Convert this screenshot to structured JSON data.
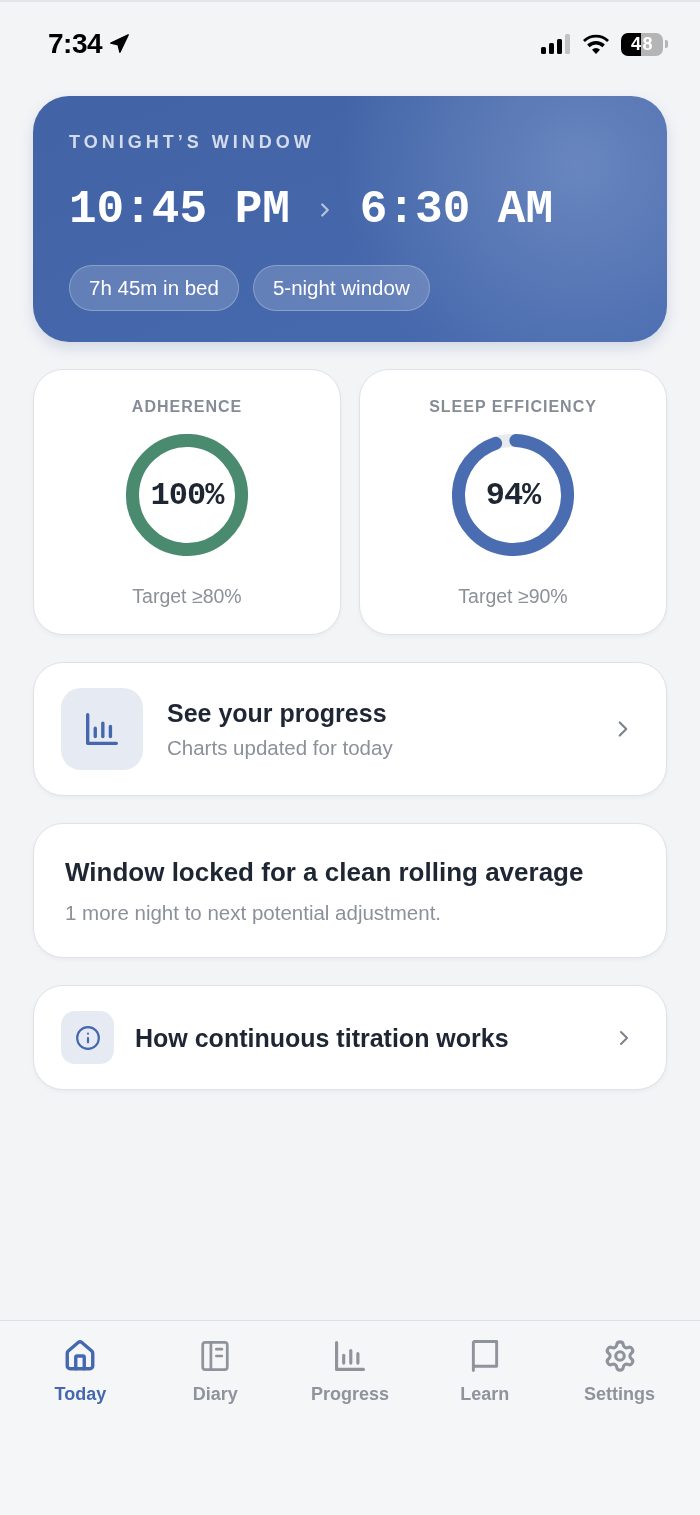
{
  "status_bar": {
    "time": "7:34",
    "battery": "48"
  },
  "window_card": {
    "title": "TONIGHT’S WINDOW",
    "start": "10:45 PM",
    "end": "6:30 AM",
    "chips": [
      "7h 45m in bed",
      "5-night window"
    ]
  },
  "metrics": [
    {
      "label": "ADHERENCE",
      "value": "100%",
      "level": 1,
      "color": "#4a8a6e",
      "target": "Target ≥80%"
    },
    {
      "label": "SLEEP EFFICIENCY",
      "value": "94%",
      "level": 0.94,
      "color": "#4a6cb0",
      "target": "Target ≥90%"
    }
  ],
  "progress_card": {
    "title": "See your progress",
    "subtitle": "Charts updated for today"
  },
  "notice_card": {
    "title": "Window locked for a clean rolling average",
    "text": "1 more night to next potential adjustment."
  },
  "info_card": {
    "title": "How continuous titration works"
  },
  "tab_bar": {
    "tabs": [
      {
        "label": "Today",
        "selected": true
      },
      {
        "label": "Diary",
        "selected": false
      },
      {
        "label": "Progress",
        "selected": false
      },
      {
        "label": "Learn",
        "selected": false
      },
      {
        "label": "Settings",
        "selected": false
      }
    ]
  }
}
